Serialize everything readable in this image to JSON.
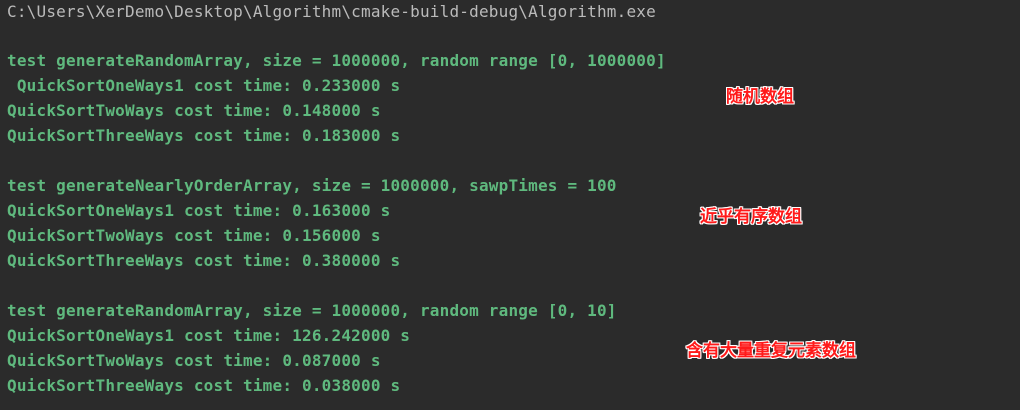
{
  "console": {
    "exe_path": "C:\\Users\\XerDemo\\Desktop\\Algorithm\\cmake-build-debug\\Algorithm.exe",
    "blocks": [
      {
        "header": "test generateRandomArray, size = 1000000, random range [0, 1000000]",
        "lines": [
          " QuickSortOneWays1 cost time: 0.233000 s",
          "QuickSortTwoWays cost time: 0.148000 s",
          "QuickSortThreeWays cost time: 0.183000 s"
        ],
        "annotation": "随机数组"
      },
      {
        "header": "test generateNearlyOrderArray, size = 1000000, sawpTimes = 100",
        "lines": [
          "QuickSortOneWays1 cost time: 0.163000 s",
          "QuickSortTwoWays cost time: 0.156000 s",
          "QuickSortThreeWays cost time: 0.380000 s"
        ],
        "annotation": "近乎有序数组"
      },
      {
        "header": "test generateRandomArray, size = 1000000, random range [0, 10]",
        "lines": [
          "QuickSortOneWays1 cost time: 126.242000 s",
          "QuickSortTwoWays cost time: 0.087000 s",
          "QuickSortThreeWays cost time: 0.038000 s"
        ],
        "annotation": "含有大量重复元素数组"
      }
    ]
  },
  "colors": {
    "background": "#2b2b2b",
    "path_text": "#bbbbbb",
    "output_text": "#5fb97e",
    "annotation_text": "#ff1a1a"
  }
}
